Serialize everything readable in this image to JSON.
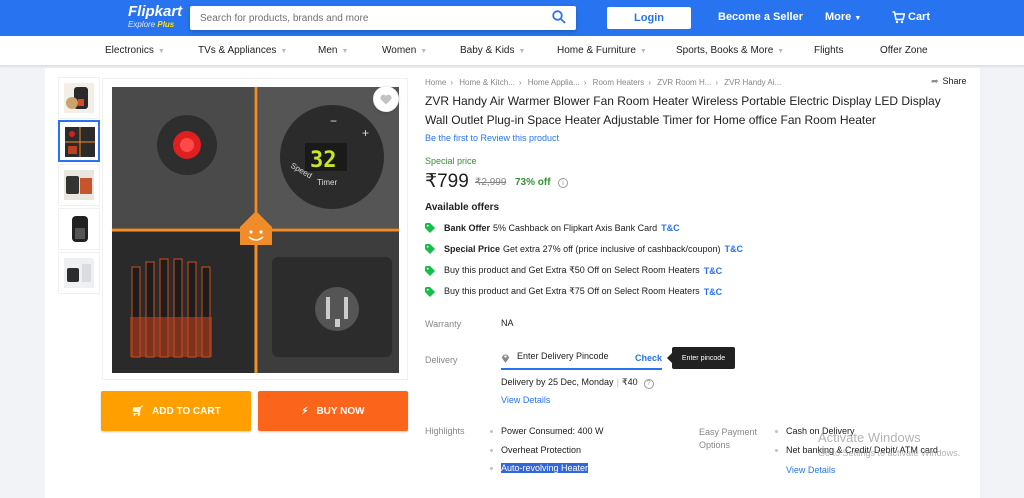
{
  "header": {
    "logo": "Flipkart",
    "logo_sub_a": "Explore",
    "logo_sub_b": "Plus",
    "search_placeholder": "Search for products, brands and more",
    "login": "Login",
    "seller": "Become a Seller",
    "more": "More",
    "cart": "Cart",
    "brand_color": "#2874f0"
  },
  "nav": [
    "Electronics",
    "TVs & Appliances",
    "Men",
    "Women",
    "Baby & Kids",
    "Home & Furniture",
    "Sports, Books & More",
    "Flights",
    "Offer Zone"
  ],
  "breadcrumbs": [
    "Home",
    "Home & Kitch...",
    "Home Applia...",
    "Room Heaters",
    "ZVR Room H...",
    "ZVR Handy Ai..."
  ],
  "share": "Share",
  "product": {
    "title": "ZVR Handy Air Warmer Blower Fan Room Heater Wireless Portable Electric Display LED Display Wall Outlet Plug-in Space Heater Adjustable Timer for Home office Fan Room Heater",
    "review_link": "Be the first to Review this product",
    "special_price_label": "Special price",
    "price": "₹799",
    "mrp": "₹2,999",
    "discount": "73% off",
    "image_display": "32",
    "image_label_speed": "Speed",
    "image_label_timer": "Timer"
  },
  "offers": {
    "heading": "Available offers",
    "items": [
      {
        "bold": "Bank Offer",
        "text": "5% Cashback on Flipkart Axis Bank Card",
        "tc": "T&C"
      },
      {
        "bold": "Special Price",
        "text": "Get extra 27% off (price inclusive of cashback/coupon)",
        "tc": "T&C"
      },
      {
        "bold": "",
        "text": "Buy this product and Get Extra ₹50 Off on Select Room Heaters",
        "tc": "T&C"
      },
      {
        "bold": "",
        "text": "Buy this product and Get Extra ₹75 Off on Select Room Heaters",
        "tc": "T&C"
      }
    ]
  },
  "warranty": {
    "label": "Warranty",
    "value": "NA"
  },
  "delivery": {
    "label": "Delivery",
    "pincode_placeholder": "Enter Delivery Pincode",
    "check": "Check",
    "tooltip": "Enter pincode",
    "date": "Delivery by 25 Dec, Monday",
    "charge": "₹40",
    "view_details": "View Details"
  },
  "highlights": {
    "label": "Highlights",
    "items": [
      "Power Consumed: 400 W",
      "Overheat Protection",
      "Auto-revolving Heater"
    ]
  },
  "payment": {
    "label": "Easy Payment Options",
    "items": [
      "Cash on Delivery",
      "Net banking & Credit/ Debit/ ATM card"
    ],
    "view_details": "View Details"
  },
  "buttons": {
    "add_to_cart": "ADD TO CART",
    "buy_now": "BUY NOW"
  },
  "watermark": {
    "line1": "Activate Windows",
    "line2": "Go to Settings to activate Windows."
  }
}
